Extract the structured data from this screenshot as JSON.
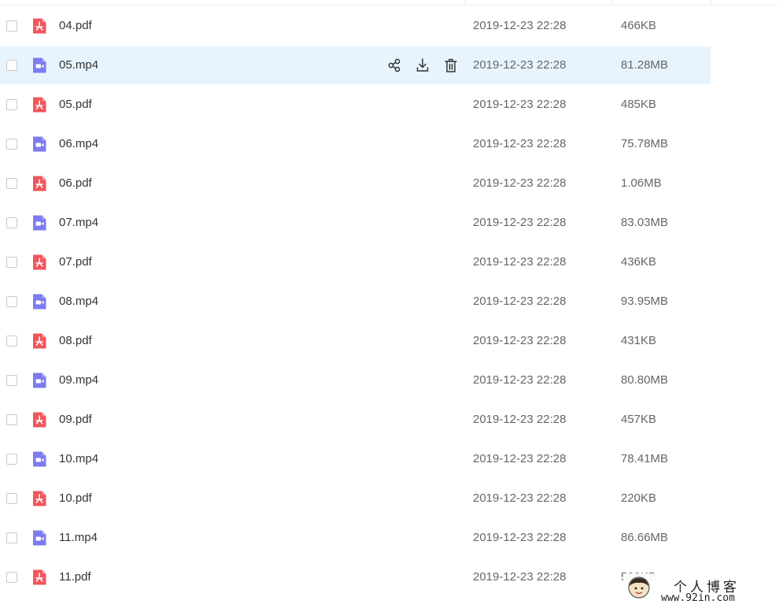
{
  "files": [
    {
      "name": "04.pdf",
      "type": "pdf",
      "modified": "2019-12-23 22:28",
      "size": "466KB"
    },
    {
      "name": "05.mp4",
      "type": "video",
      "modified": "2019-12-23 22:28",
      "size": "81.28MB",
      "hovered": true
    },
    {
      "name": "05.pdf",
      "type": "pdf",
      "modified": "2019-12-23 22:28",
      "size": "485KB"
    },
    {
      "name": "06.mp4",
      "type": "video",
      "modified": "2019-12-23 22:28",
      "size": "75.78MB"
    },
    {
      "name": "06.pdf",
      "type": "pdf",
      "modified": "2019-12-23 22:28",
      "size": "1.06MB"
    },
    {
      "name": "07.mp4",
      "type": "video",
      "modified": "2019-12-23 22:28",
      "size": "83.03MB"
    },
    {
      "name": "07.pdf",
      "type": "pdf",
      "modified": "2019-12-23 22:28",
      "size": "436KB"
    },
    {
      "name": "08.mp4",
      "type": "video",
      "modified": "2019-12-23 22:28",
      "size": "93.95MB"
    },
    {
      "name": "08.pdf",
      "type": "pdf",
      "modified": "2019-12-23 22:28",
      "size": "431KB"
    },
    {
      "name": "09.mp4",
      "type": "video",
      "modified": "2019-12-23 22:28",
      "size": "80.80MB"
    },
    {
      "name": "09.pdf",
      "type": "pdf",
      "modified": "2019-12-23 22:28",
      "size": "457KB"
    },
    {
      "name": "10.mp4",
      "type": "video",
      "modified": "2019-12-23 22:28",
      "size": "78.41MB"
    },
    {
      "name": "10.pdf",
      "type": "pdf",
      "modified": "2019-12-23 22:28",
      "size": "220KB"
    },
    {
      "name": "11.mp4",
      "type": "video",
      "modified": "2019-12-23 22:28",
      "size": "86.66MB"
    },
    {
      "name": "11.pdf",
      "type": "pdf",
      "modified": "2019-12-23 22:28",
      "size": "590KB"
    }
  ],
  "row_actions": [
    {
      "icon": "share-icon"
    },
    {
      "icon": "download-icon"
    },
    {
      "icon": "delete-icon"
    }
  ],
  "watermark": {
    "title": "个人博客",
    "url": "www.92in.com"
  },
  "colors": {
    "pdf_icon": "#f2555a",
    "video_icon": "#7b7cf0",
    "hover_row": "#e8f4fd",
    "text_primary": "#333333",
    "text_secondary": "#666666"
  }
}
